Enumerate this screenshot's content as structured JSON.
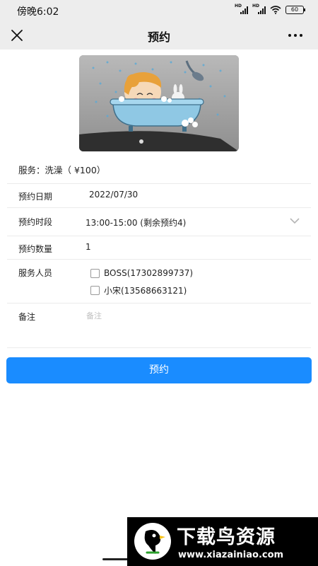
{
  "status_bar": {
    "time": "傍晚6:02",
    "signal_label": "HD",
    "battery": "60"
  },
  "nav": {
    "title": "预约"
  },
  "service": {
    "text": "服务：洗澡（ ¥100）"
  },
  "form": {
    "date_label": "预约日期",
    "date_value": "2022/07/30",
    "slot_label": "预约时段",
    "slot_value": "13:00-15:00 (剩余预约4)",
    "quantity_label": "预约数量",
    "quantity_value": "1",
    "staff_label": "服务人员",
    "staff": [
      {
        "name": "BOSS(17302899737)",
        "checked": false
      },
      {
        "name": "小宋(13568663121)",
        "checked": false
      }
    ],
    "note_label": "备注",
    "note_placeholder": "备注"
  },
  "submit_label": "预约",
  "watermark": {
    "title": "下载鸟资源",
    "url": "www.xiazainiao.com"
  },
  "colors": {
    "primary": "#1a8cff",
    "header_bg": "#ededed",
    "divider": "#ebebeb",
    "placeholder": "#c0c0c0"
  }
}
